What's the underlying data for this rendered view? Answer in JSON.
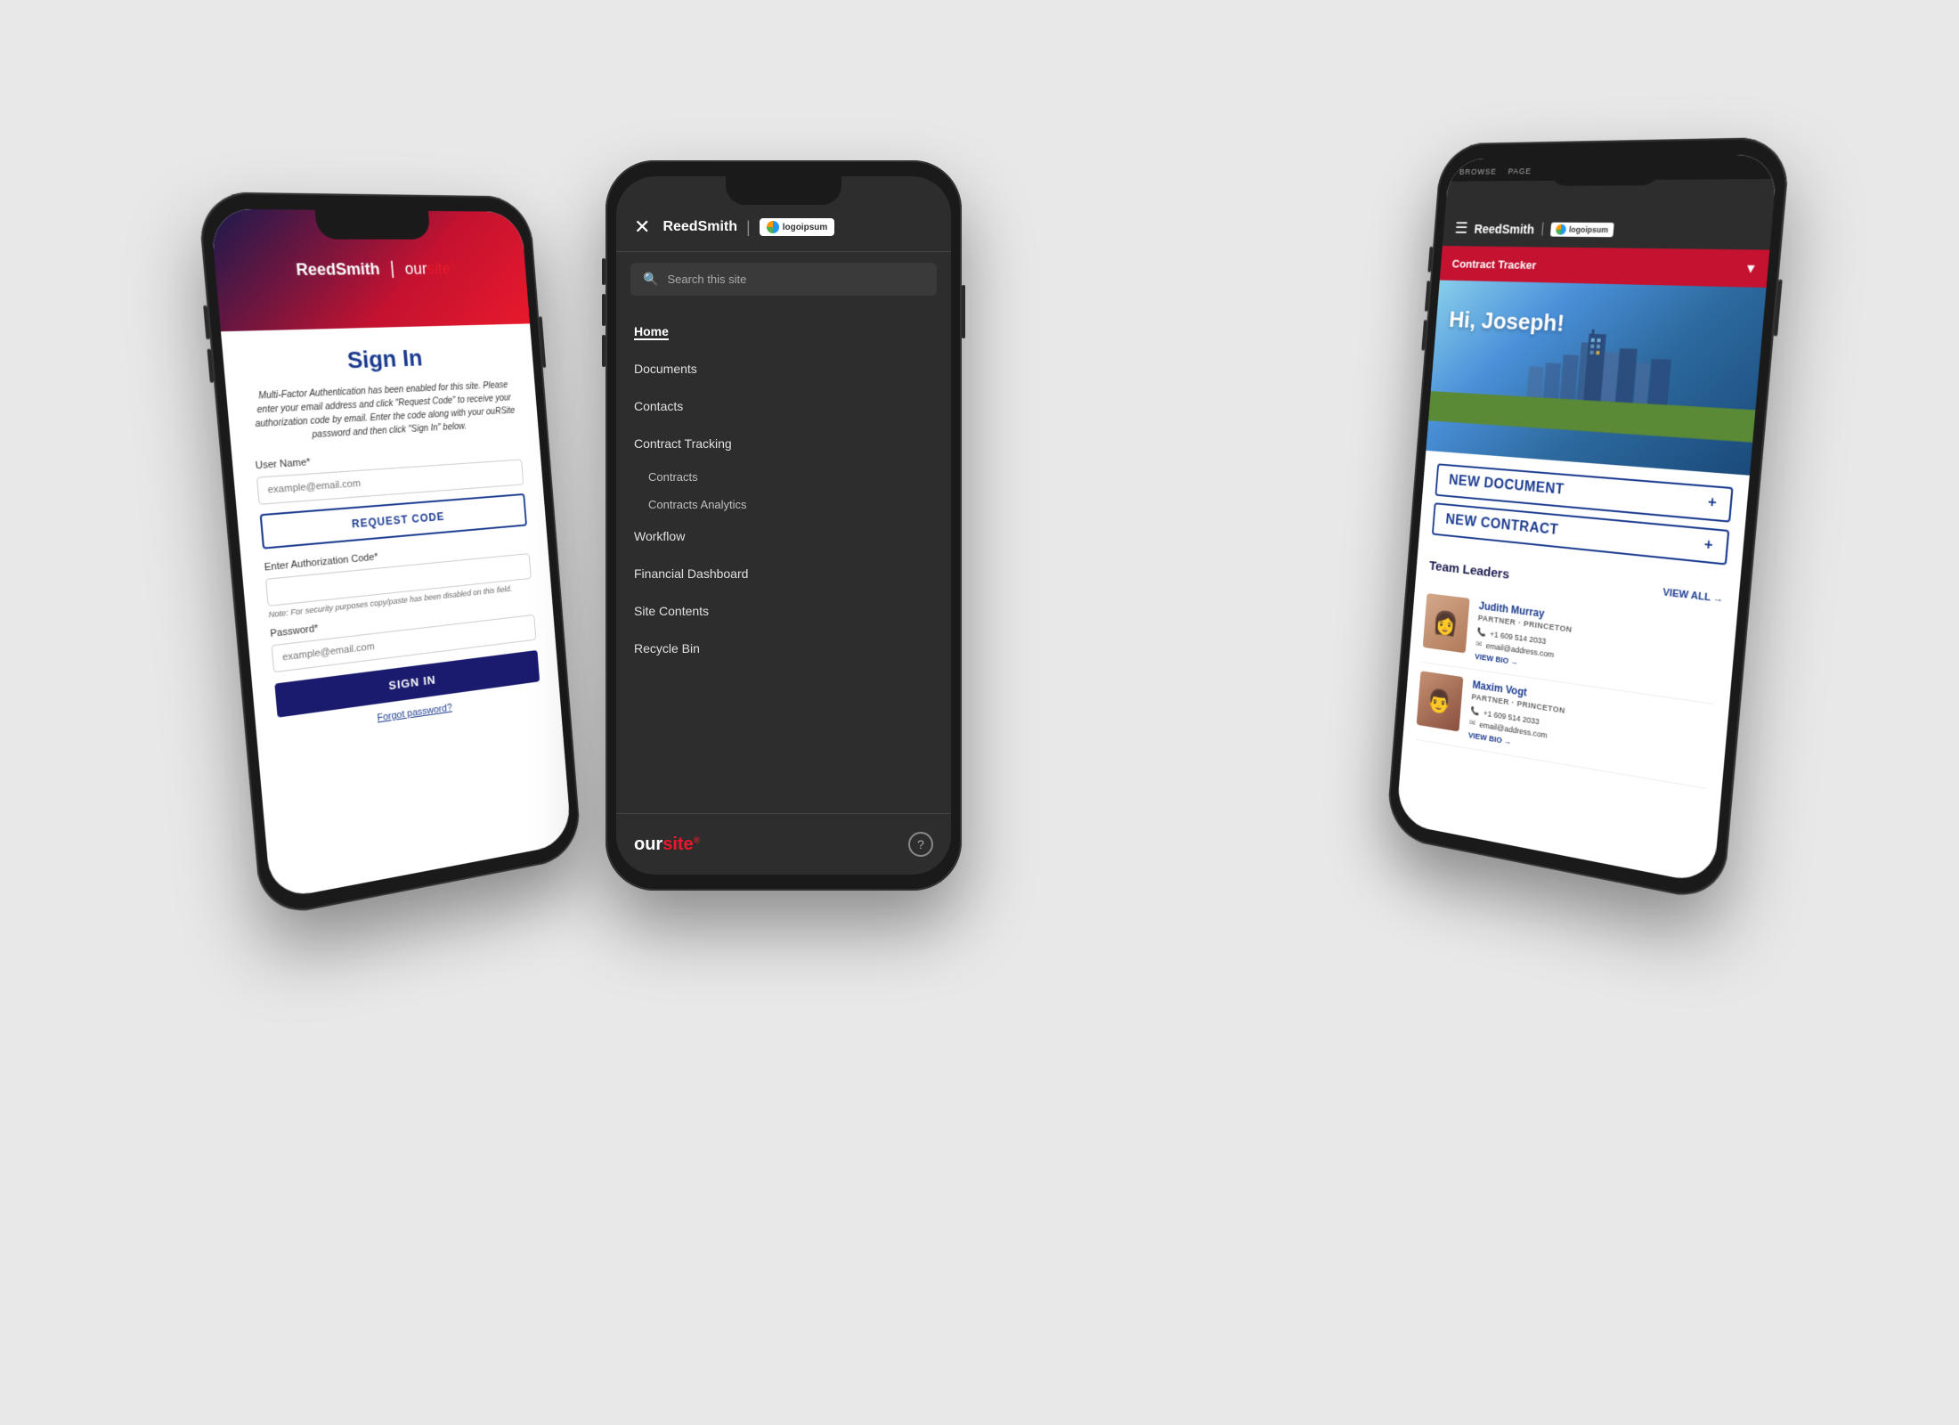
{
  "background": "#e8e8e8",
  "phones": {
    "left": {
      "header": {
        "brand_name": "ReedSmith",
        "separator": "|",
        "site_name": "our",
        "site_accent": "site"
      },
      "signin": {
        "title": "Sign In",
        "description": "Multi-Factor Authentication has been enabled for this site. Please enter your email address and click \"Request Code\" to receive your authorization code by email. Enter the code along with your ouRSite password and then click \"Sign In\" below.",
        "username_label": "User Name*",
        "username_placeholder": "example@email.com",
        "request_code_btn": "REQUEST CODE",
        "auth_code_label": "Enter Authorization Code*",
        "auth_note": "Note: For security purposes copy/paste has been disabled on this field.",
        "password_label": "Password*",
        "password_placeholder": "example@email.com",
        "sign_in_btn": "SIGN IN",
        "forgot_password": "Forgot password?"
      }
    },
    "center": {
      "header": {
        "brand_name": "ReedSmith",
        "separator": "|",
        "logo_text": "logoipsum"
      },
      "search": {
        "placeholder": "Search this site"
      },
      "menu": [
        {
          "label": "Home",
          "active": true
        },
        {
          "label": "Documents",
          "active": false
        },
        {
          "label": "Contacts",
          "active": false
        },
        {
          "label": "Contract Tracking",
          "active": false,
          "children": [
            {
              "label": "Contracts"
            },
            {
              "label": "Contracts Analytics"
            }
          ]
        },
        {
          "label": "Workflow",
          "active": false
        },
        {
          "label": "Financial Dashboard",
          "active": false
        },
        {
          "label": "Site Contents",
          "active": false
        },
        {
          "label": "Recycle Bin",
          "active": false
        }
      ],
      "footer": {
        "brand": "our",
        "brand_accent": "site",
        "help_icon": "?"
      }
    },
    "right": {
      "topbar": {
        "brand_name": "ReedSmith",
        "separator": "|",
        "logo_text": "logoipsum"
      },
      "tracker_bar": {
        "title": "Contract Tracker",
        "chevron": "▾"
      },
      "browse_page": {
        "browse": "BROWSE",
        "page": "PAGE"
      },
      "hero": {
        "greeting": "Hi, Joseph!"
      },
      "actions": [
        {
          "label": "NEW DOCUMENT",
          "icon": "+"
        },
        {
          "label": "NEW CONTRACT",
          "icon": "+"
        }
      ],
      "team": {
        "title": "Team Leaders",
        "view_all": "VIEW ALL",
        "members": [
          {
            "name": "Judith Murray",
            "role": "PARTNER · PRINCETON",
            "phone": "+1 609 514 2033",
            "email": "email@address.com",
            "view_bio": "VIEW BIO",
            "avatar_color": "#c8a882"
          },
          {
            "name": "Maxim Vogt",
            "role": "PARTNER · PRINCETON",
            "phone": "+1 609 514 2033",
            "email": "email@address.com",
            "view_bio": "VIEW BIO",
            "avatar_color": "#b8927a"
          }
        ]
      }
    }
  }
}
